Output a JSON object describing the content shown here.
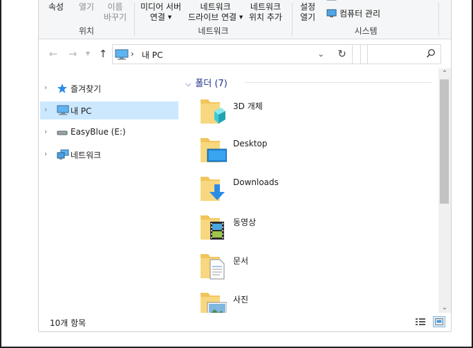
{
  "ribbon": {
    "group_location": {
      "label": "위치",
      "properties": "속성",
      "open": "열기",
      "rename_line1": "이름",
      "rename_line2": "바꾸기"
    },
    "group_network": {
      "label": "네트워크",
      "media_server_line1": "미디어 서버",
      "media_server_line2": "연결",
      "map_drive_line1": "네트워크",
      "map_drive_line2": "드라이브 연결",
      "add_location_line1": "네트워크",
      "add_location_line2": "위치 추가"
    },
    "group_system": {
      "label": "시스템",
      "settings_line1": "설정",
      "settings_line2": "열기",
      "manage": "컴퓨터 관리"
    }
  },
  "address": {
    "crumb": "내 PC"
  },
  "search": {
    "placeholder": ""
  },
  "tree": {
    "items": [
      {
        "label": "즐겨찾기",
        "icon": "star-icon"
      },
      {
        "label": "내 PC",
        "icon": "pc-icon",
        "selected": true
      },
      {
        "label": "EasyBlue (E:)",
        "icon": "drive-icon"
      },
      {
        "label": "네트워크",
        "icon": "network-icon"
      }
    ]
  },
  "content": {
    "group_title": "폴더 (7)",
    "folders": [
      {
        "name": "3D 개체",
        "icon": "3d-objects-folder-icon"
      },
      {
        "name": "Desktop",
        "icon": "desktop-folder-icon"
      },
      {
        "name": "Downloads",
        "icon": "downloads-folder-icon"
      },
      {
        "name": "동영상",
        "icon": "videos-folder-icon"
      },
      {
        "name": "문서",
        "icon": "documents-folder-icon"
      },
      {
        "name": "사진",
        "icon": "pictures-folder-icon"
      }
    ]
  },
  "status": {
    "count": "10개 항목"
  },
  "colors": {
    "selection": "#cce8ff",
    "group_header": "#1e3287",
    "folder": "#f2c55c"
  }
}
